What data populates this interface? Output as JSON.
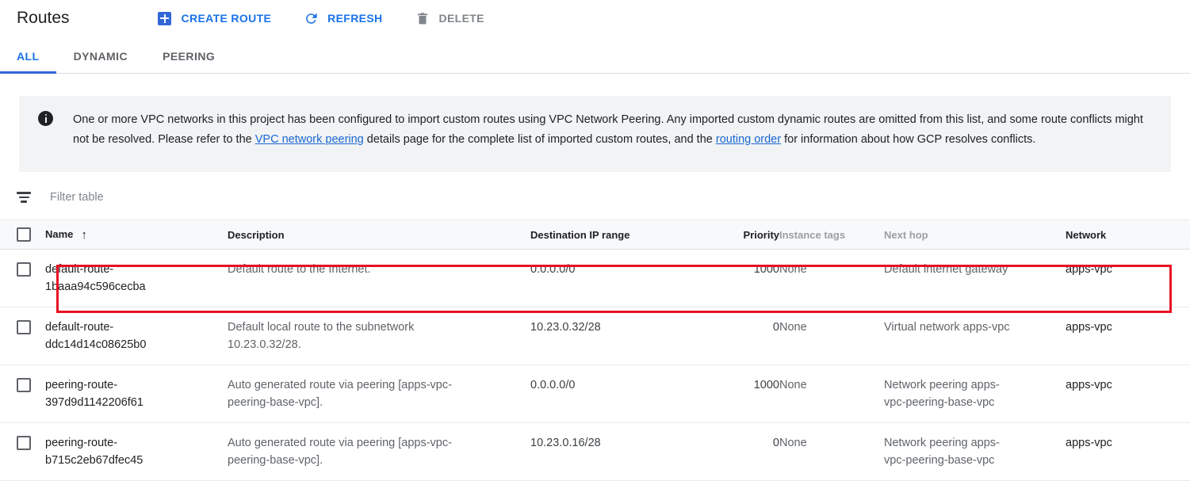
{
  "header": {
    "title": "Routes",
    "actions": [
      {
        "label": "CREATE ROUTE",
        "icon": "plus-square-icon",
        "state": "enabled"
      },
      {
        "label": "REFRESH",
        "icon": "refresh-icon",
        "state": "enabled"
      },
      {
        "label": "DELETE",
        "icon": "trash-icon",
        "state": "disabled"
      }
    ]
  },
  "tabs": [
    {
      "label": "ALL",
      "active": true
    },
    {
      "label": "DYNAMIC",
      "active": false
    },
    {
      "label": "PEERING",
      "active": false
    }
  ],
  "banner": {
    "icon": "info-icon",
    "text_1": "One or more VPC networks in this project has been configured to import custom routes using VPC Network Peering. Any imported custom dynamic routes are omitted from this list, and some route conflicts might not be resolved. Please refer to the ",
    "link_1": "VPC network peering",
    "text_2": " details page for the complete list of imported custom routes, and the ",
    "link_2": "routing order",
    "text_3": " for information about how GCP resolves conflicts."
  },
  "filter": {
    "icon": "filter-icon",
    "placeholder": "Filter table",
    "value": ""
  },
  "table": {
    "columns": [
      {
        "label": "Name",
        "sorted": "asc",
        "muted": false
      },
      {
        "label": "Description",
        "muted": false
      },
      {
        "label": "Destination IP range",
        "muted": false
      },
      {
        "label": "Priority",
        "muted": false,
        "align": "right"
      },
      {
        "label": "Instance tags",
        "muted": true
      },
      {
        "label": "Next hop",
        "muted": true
      },
      {
        "label": "Network",
        "muted": false
      }
    ],
    "rows": [
      {
        "name": "default-route-1baaa94c596cecba",
        "description": "Default route to the Internet.",
        "destination_ip_range": "0.0.0.0/0",
        "priority": "1000",
        "instance_tags": "None",
        "next_hop": "Default internet gateway",
        "network": "apps-vpc",
        "highlighted": true
      },
      {
        "name": "default-route-ddc14d14c08625b0",
        "description": "Default local route to the subnetwork 10.23.0.32/28.",
        "destination_ip_range": "10.23.0.32/28",
        "priority": "0",
        "instance_tags": "None",
        "next_hop": "Virtual network apps-vpc",
        "network": "apps-vpc",
        "highlighted": false
      },
      {
        "name": "peering-route-397d9d1142206f61",
        "description": "Auto generated route via peering [apps-vpc-peering-base-vpc].",
        "destination_ip_range": "0.0.0.0/0",
        "priority": "1000",
        "instance_tags": "None",
        "next_hop": "Network peering apps-vpc-peering-base-vpc",
        "network": "apps-vpc",
        "highlighted": false
      },
      {
        "name": "peering-route-b715c2eb67dfec45",
        "description": "Auto generated route via peering [apps-vpc-peering-base-vpc].",
        "destination_ip_range": "10.23.0.16/28",
        "priority": "0",
        "instance_tags": "None",
        "next_hop": "Network peering apps-vpc-peering-base-vpc",
        "network": "apps-vpc",
        "highlighted": false
      }
    ]
  },
  "colors": {
    "accent": "#1a73e8",
    "tab_underline": "#3367d6",
    "highlight": "#e81123",
    "banner_bg": "#f1f3f4",
    "header_bg": "#f8f9fa",
    "muted_text": "#9aa0a6"
  }
}
